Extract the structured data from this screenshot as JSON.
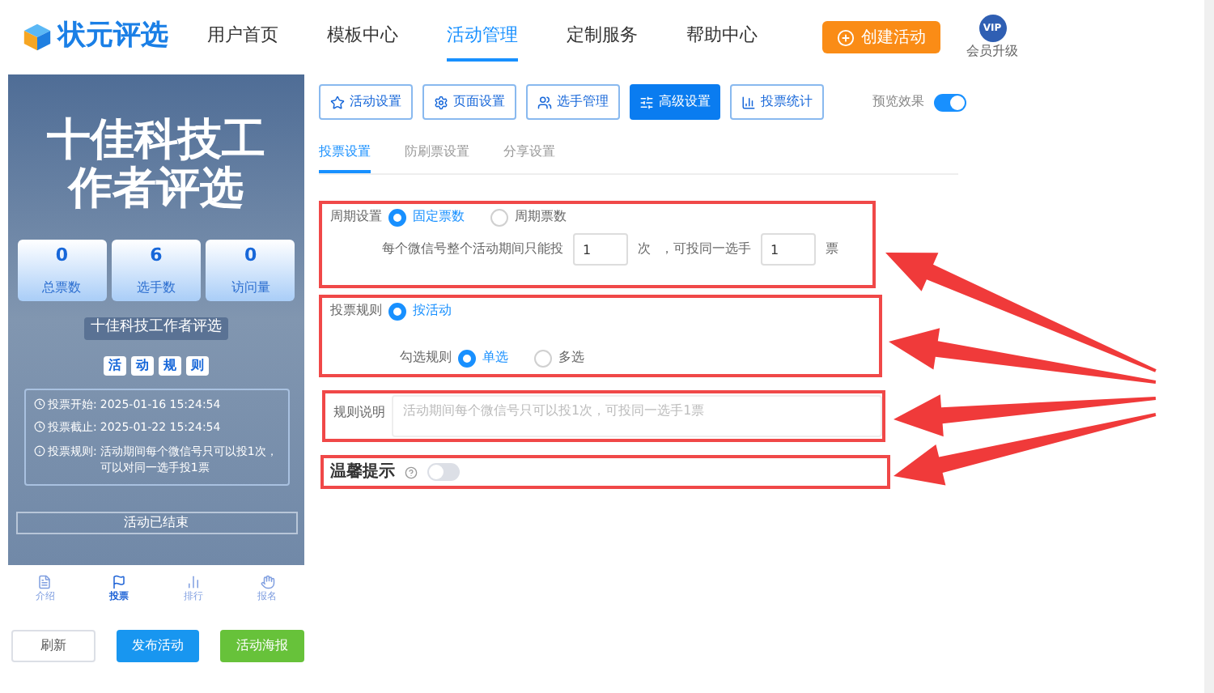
{
  "header": {
    "logo": "状元评选",
    "nav": [
      {
        "label": "用户首页",
        "selected": false
      },
      {
        "label": "模板中心",
        "selected": false
      },
      {
        "label": "活动管理",
        "selected": true
      },
      {
        "label": "定制服务",
        "selected": false
      },
      {
        "label": "帮助中心",
        "selected": false
      }
    ],
    "create_button": "创建活动",
    "vip_badge": "VIP",
    "vip_label": "会员升级"
  },
  "preview": {
    "banner_lines": [
      "十佳科技工",
      "作者评选"
    ],
    "stats": [
      {
        "value": "0",
        "label": "总票数"
      },
      {
        "value": "6",
        "label": "选手数"
      },
      {
        "value": "0",
        "label": "访问量"
      }
    ],
    "activity_name": "十佳科技工作者评选",
    "rules_chars": [
      "活",
      "动",
      "规",
      "则"
    ],
    "info": [
      {
        "kind": "clock",
        "label": "投票开始:",
        "value": "2025-01-16 15:24:54"
      },
      {
        "kind": "clock",
        "label": "投票截止:",
        "value": "2025-01-22 15:24:54"
      },
      {
        "kind": "info",
        "label": "投票规则:",
        "value": "活动期间每个微信号只可以投1次，可以对同一选手投1票"
      }
    ],
    "status": "活动已结束",
    "bottom_nav": [
      {
        "kind": "intro",
        "label": "介绍",
        "selected": false
      },
      {
        "kind": "vote",
        "label": "投票",
        "selected": true
      },
      {
        "kind": "rank",
        "label": "排行",
        "selected": false
      },
      {
        "kind": "signup",
        "label": "报名",
        "selected": false
      }
    ]
  },
  "actions": [
    {
      "kind": "outline",
      "label": "刷新"
    },
    {
      "kind": "primary",
      "label": "发布活动"
    },
    {
      "kind": "success",
      "label": "活动海报"
    }
  ],
  "toolbar": [
    {
      "kind": "star",
      "label": "活动设置",
      "selected": false
    },
    {
      "kind": "gear",
      "label": "页面设置",
      "selected": false
    },
    {
      "kind": "users",
      "label": "选手管理",
      "selected": false
    },
    {
      "kind": "sliders",
      "label": "高级设置",
      "selected": true
    },
    {
      "kind": "chart",
      "label": "投票统计",
      "selected": false
    }
  ],
  "preview_toggle": {
    "label": "预览效果",
    "on": true
  },
  "tabs": [
    {
      "label": "投票设置",
      "selected": true
    },
    {
      "label": "防刷票设置",
      "selected": false
    },
    {
      "label": "分享设置",
      "selected": false
    }
  ],
  "cycle": {
    "label": "周期设置",
    "options": [
      {
        "label": "固定票数",
        "selected": true
      },
      {
        "label": "周期票数",
        "selected": false
      }
    ],
    "sentence_start": "每个微信号整个活动期间只能投",
    "times_value": "1",
    "times_unit": "次",
    "sentence_mid": "，可投同一选手",
    "votes_value": "1",
    "votes_unit": "票"
  },
  "rule": {
    "label": "投票规则",
    "options": [
      {
        "label": "按活动",
        "selected": true
      }
    ],
    "pick_label": "勾选规则",
    "pick_options": [
      {
        "label": "单选",
        "selected": true
      },
      {
        "label": "多选",
        "selected": false
      }
    ]
  },
  "description": {
    "label": "规则说明",
    "placeholder": "活动期间每个微信号只可以投1次，可投同一选手1票"
  },
  "tip": {
    "label": "温馨提示",
    "on": false
  }
}
